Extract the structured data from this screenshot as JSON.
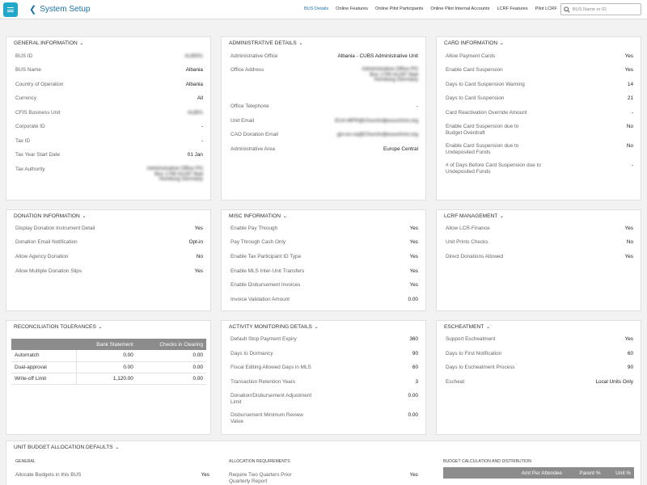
{
  "header": {
    "title": "System Setup",
    "nav": [
      "BUS Details",
      "Online Features",
      "Online Pilot Participants",
      "Online Pilot Internal Accounts",
      "LCRF Features",
      "Pilot LCRF"
    ],
    "active_nav": "BUS Details",
    "search_placeholder": "BUS Name or ID"
  },
  "general": {
    "title": "GENERAL INFORMATION",
    "rows": [
      {
        "label": "BUS ID",
        "value": "ALB001"
      },
      {
        "label": "BUS Name",
        "value": "Albania"
      },
      {
        "label": "Country of Operation",
        "value": "Albania"
      },
      {
        "label": "Currency",
        "value": "All"
      },
      {
        "label": "CFIS Business Unit",
        "value": "ALB01"
      },
      {
        "label": "Corporate ID",
        "value": "-"
      },
      {
        "label": "Tax ID",
        "value": "-"
      },
      {
        "label": "Tax Year Start Date",
        "value": "01 Jan"
      },
      {
        "label": "Tax Authority",
        "value": "Administrative Office PO Box 1765 61287 Bad Homburg Germany"
      }
    ]
  },
  "admin": {
    "title": "ADMINISTRATIVE DETAILS",
    "rows": [
      {
        "label": "Administrative Office",
        "value": "Albania - CUBS Administrative Unit"
      },
      {
        "label": "Office Address",
        "value": "Administrative Office PO Box 1765 61287 Bad Homburg Germany"
      },
      {
        "label": "Office Telephone",
        "value": "-"
      },
      {
        "label": "Unit Email",
        "value": "EUA-MFR@Churchofjesuschrist.org"
      },
      {
        "label": "CAO Donation Email",
        "value": "gio-eu-sa@Churchofjesuschrist.org"
      },
      {
        "label": "Administrative Area",
        "value": "Europe Central"
      }
    ]
  },
  "card": {
    "title": "CARD INFORMATION",
    "rows": [
      {
        "label": "Allow Payment Cards",
        "value": "Yes"
      },
      {
        "label": "Enable Card Suspension",
        "value": "Yes"
      },
      {
        "label": "Days to Card Suspension Warning",
        "value": "14"
      },
      {
        "label": "Days to Card Suspension",
        "value": "21"
      },
      {
        "label": "Card Reactivation Override Amount",
        "value": "-"
      },
      {
        "label": "Enable Card Suspension due to Budget Overdraft",
        "value": "No"
      },
      {
        "label": "Enable Card Suspension due to Undeposited Funds",
        "value": "No"
      },
      {
        "label": "# of Days Before Card Suspension due to Undeposited Funds",
        "value": "-"
      }
    ]
  },
  "donation": {
    "title": "DONATION INFORMATION",
    "rows": [
      {
        "label": "Display Donation Instrument Detail",
        "value": "Yes"
      },
      {
        "label": "Donation Email Notification",
        "value": "Opt-in"
      },
      {
        "label": "Allow Agency Donation",
        "value": "No"
      },
      {
        "label": "Allow Multiple Donation Slips",
        "value": "Yes"
      }
    ]
  },
  "misc": {
    "title": "MISC INFORMATION",
    "rows": [
      {
        "label": "Enable Pay Through",
        "value": "Yes"
      },
      {
        "label": "Pay Through Cash Only",
        "value": "Yes"
      },
      {
        "label": "Enable Tax Participant ID Type",
        "value": "Yes"
      },
      {
        "label": "Enable MLS Inter-Unit Transfers",
        "value": "Yes"
      },
      {
        "label": "Enable Disbursement Invoices",
        "value": "Yes"
      },
      {
        "label": "Invoice Validation Amount",
        "value": "0.00"
      }
    ]
  },
  "lcrf": {
    "title": "LCRF MANAGEMENT",
    "rows": [
      {
        "label": "Allow LCR-Finance",
        "value": "Yes"
      },
      {
        "label": "Unit Prints Checks",
        "value": "No"
      },
      {
        "label": "Direct Donations Allowed",
        "value": "Yes"
      }
    ]
  },
  "recon": {
    "title": "RECONCILIATION TOLERANCES",
    "headers": [
      "",
      "Bank Statement",
      "Checks in Clearing"
    ],
    "rows": [
      [
        "Automatch",
        "0.00",
        "0.00"
      ],
      [
        "Dual-approval",
        "0.00",
        "0.00"
      ],
      [
        "Write-off Limit",
        "1,120.00",
        "0.00"
      ]
    ]
  },
  "activity": {
    "title": "ACTIVITY MONITORING DETAILS",
    "rows": [
      {
        "label": "Default Stop Payment Expiry",
        "value": "360"
      },
      {
        "label": "Days to Dormancy",
        "value": "90"
      },
      {
        "label": "Fiscal Editing Allowed Days in MLS",
        "value": "60"
      },
      {
        "label": "Transaction Retention Years",
        "value": "3"
      },
      {
        "label": "Donation/Disbursement Adjustment Limit",
        "value": "0.00"
      },
      {
        "label": "Disbursement Minimum Review Value",
        "value": "0.00"
      }
    ]
  },
  "escheat": {
    "title": "ESCHEATMENT",
    "rows": [
      {
        "label": "Support Escheatment",
        "value": "Yes"
      },
      {
        "label": "Days to First Notification",
        "value": "60"
      },
      {
        "label": "Days to Escheatment Process",
        "value": "90"
      },
      {
        "label": "Escheat",
        "value": "Local Units Only"
      }
    ]
  },
  "budget": {
    "title": "UNIT BUDGET ALLOCATION DEFAULTS",
    "general_label": "GENERAL",
    "general_row": {
      "label": "Allocate Budgets in this BUS",
      "value": "Yes"
    },
    "alloc_label": "ALLOCATION REQUIREMENTS",
    "alloc_row": {
      "label": "Require Two Quarters Prior Quarterly Report",
      "value": "Yes"
    },
    "calc_label": "BUDGET CALCULATION AND DISTRIBUTION",
    "calc_headers": [
      "",
      "Amt Per Attendee",
      "Parent %",
      "Unit %"
    ]
  }
}
